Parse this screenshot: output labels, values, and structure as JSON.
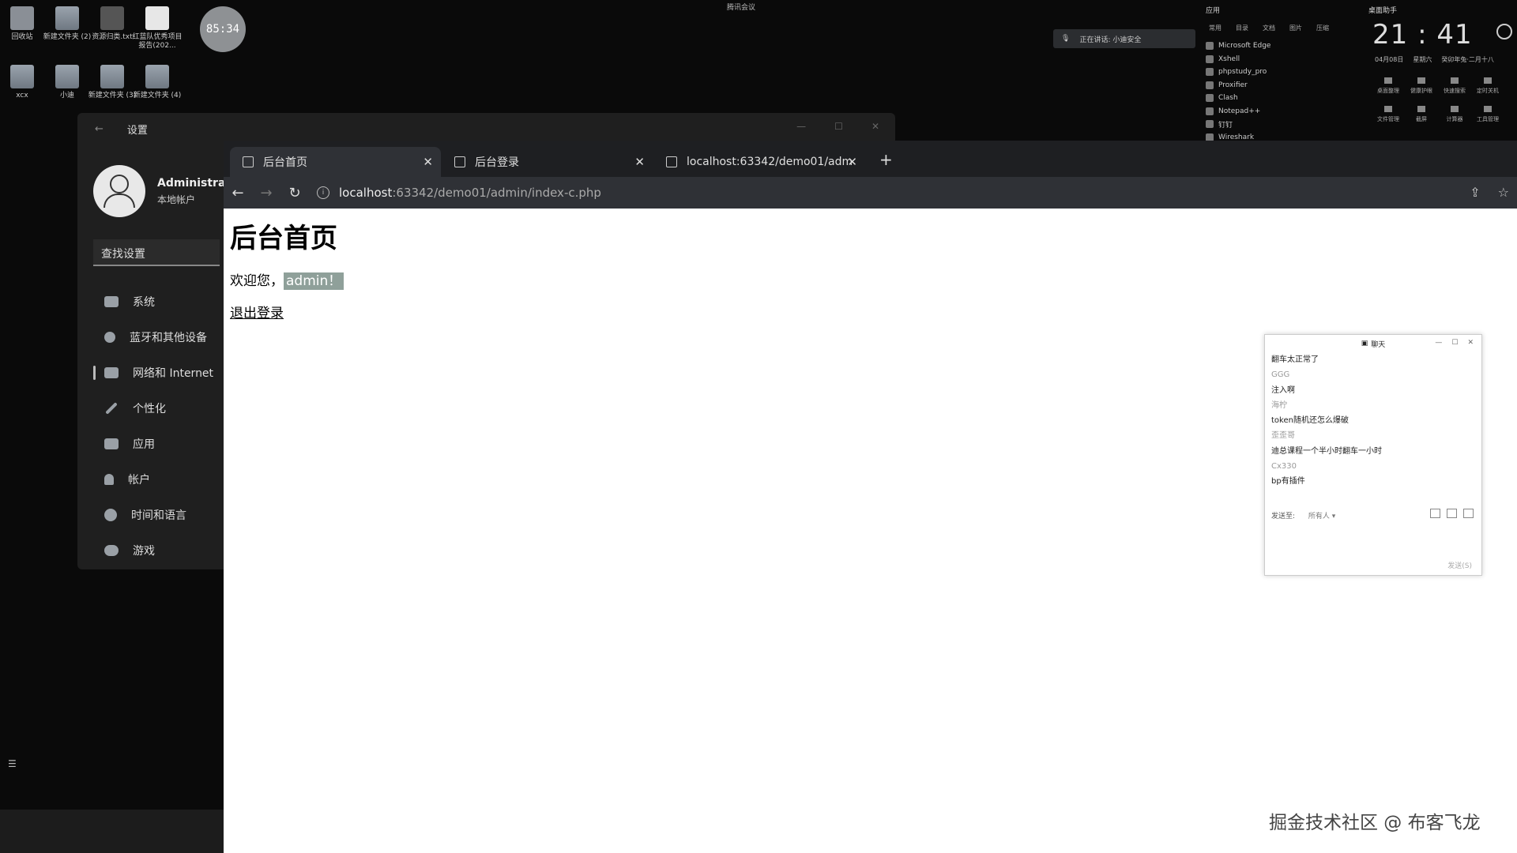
{
  "desktop": {
    "icons": [
      {
        "label": "回收站"
      },
      {
        "label": "新建文件夹 (2)"
      },
      {
        "label": "资源归类.txt"
      },
      {
        "label": "红蓝队优秀项目报告(202..."
      },
      {
        "label": "xcx"
      },
      {
        "label": "小迪"
      },
      {
        "label": "新建文件夹 (3)"
      },
      {
        "label": "新建文件夹 (4)"
      }
    ],
    "timer": "85:34",
    "meeting_indicator": "腾讯会议",
    "speaking_banner": "正在讲话: 小迪安全"
  },
  "apps_panel": {
    "title": "应用",
    "categories": [
      "常用",
      "目录",
      "文档",
      "图片",
      "压缩"
    ],
    "items": [
      "Microsoft Edge",
      "Xshell",
      "phpstudy_pro",
      "Proxifier",
      "Clash",
      "Notepad++",
      "钉钉",
      "Wireshark"
    ]
  },
  "clock_panel": {
    "title": "桌面助手",
    "time": "21 : 41",
    "date": "04月08日",
    "weekday": "星期六",
    "lunar": "癸卯年兔·二月十八",
    "tools": [
      "桌面整理",
      "健康护眼",
      "快速搜索",
      "定时关机",
      "文件管理",
      "截屏",
      "计算器",
      "工具管理"
    ]
  },
  "settings": {
    "title": "设置",
    "user_name": "Administrat",
    "user_type": "本地帐户",
    "search_placeholder": "查找设置",
    "nav": [
      {
        "label": "系统"
      },
      {
        "label": "蓝牙和其他设备"
      },
      {
        "label": "网络和 Internet"
      },
      {
        "label": "个性化"
      },
      {
        "label": "应用"
      },
      {
        "label": "帐户"
      },
      {
        "label": "时间和语言"
      },
      {
        "label": "游戏"
      }
    ]
  },
  "browser": {
    "tabs": [
      {
        "label": "后台首页"
      },
      {
        "label": "后台登录"
      },
      {
        "label": "localhost:63342/demo01/adm"
      }
    ],
    "url_host": "localhost",
    "url_path": ":63342/demo01/admin/index-c.php"
  },
  "page": {
    "heading": "后台首页",
    "welcome_prefix": "欢迎您，",
    "welcome_user": "admin！",
    "logout": "退出登录"
  },
  "chat": {
    "title": "聊天",
    "messages": [
      {
        "text": "翻车太正常了",
        "kind": "text"
      },
      {
        "text": "GGG",
        "kind": "name"
      },
      {
        "text": "注入啊",
        "kind": "text"
      },
      {
        "text": "海柠",
        "kind": "name"
      },
      {
        "text": "token随机还怎么爆破",
        "kind": "text"
      },
      {
        "text": "歪歪哥",
        "kind": "name"
      },
      {
        "text": "迪总课程一个半小时翻车一小时",
        "kind": "text"
      },
      {
        "text": "Cx330",
        "kind": "name"
      },
      {
        "text": "bp有插件",
        "kind": "text"
      }
    ],
    "send_to_label": "发送至:",
    "send_to_value": "所有人 ▾",
    "send_button": "发送(S)"
  },
  "watermark": "掘金技术社区 @ 布客飞龙"
}
